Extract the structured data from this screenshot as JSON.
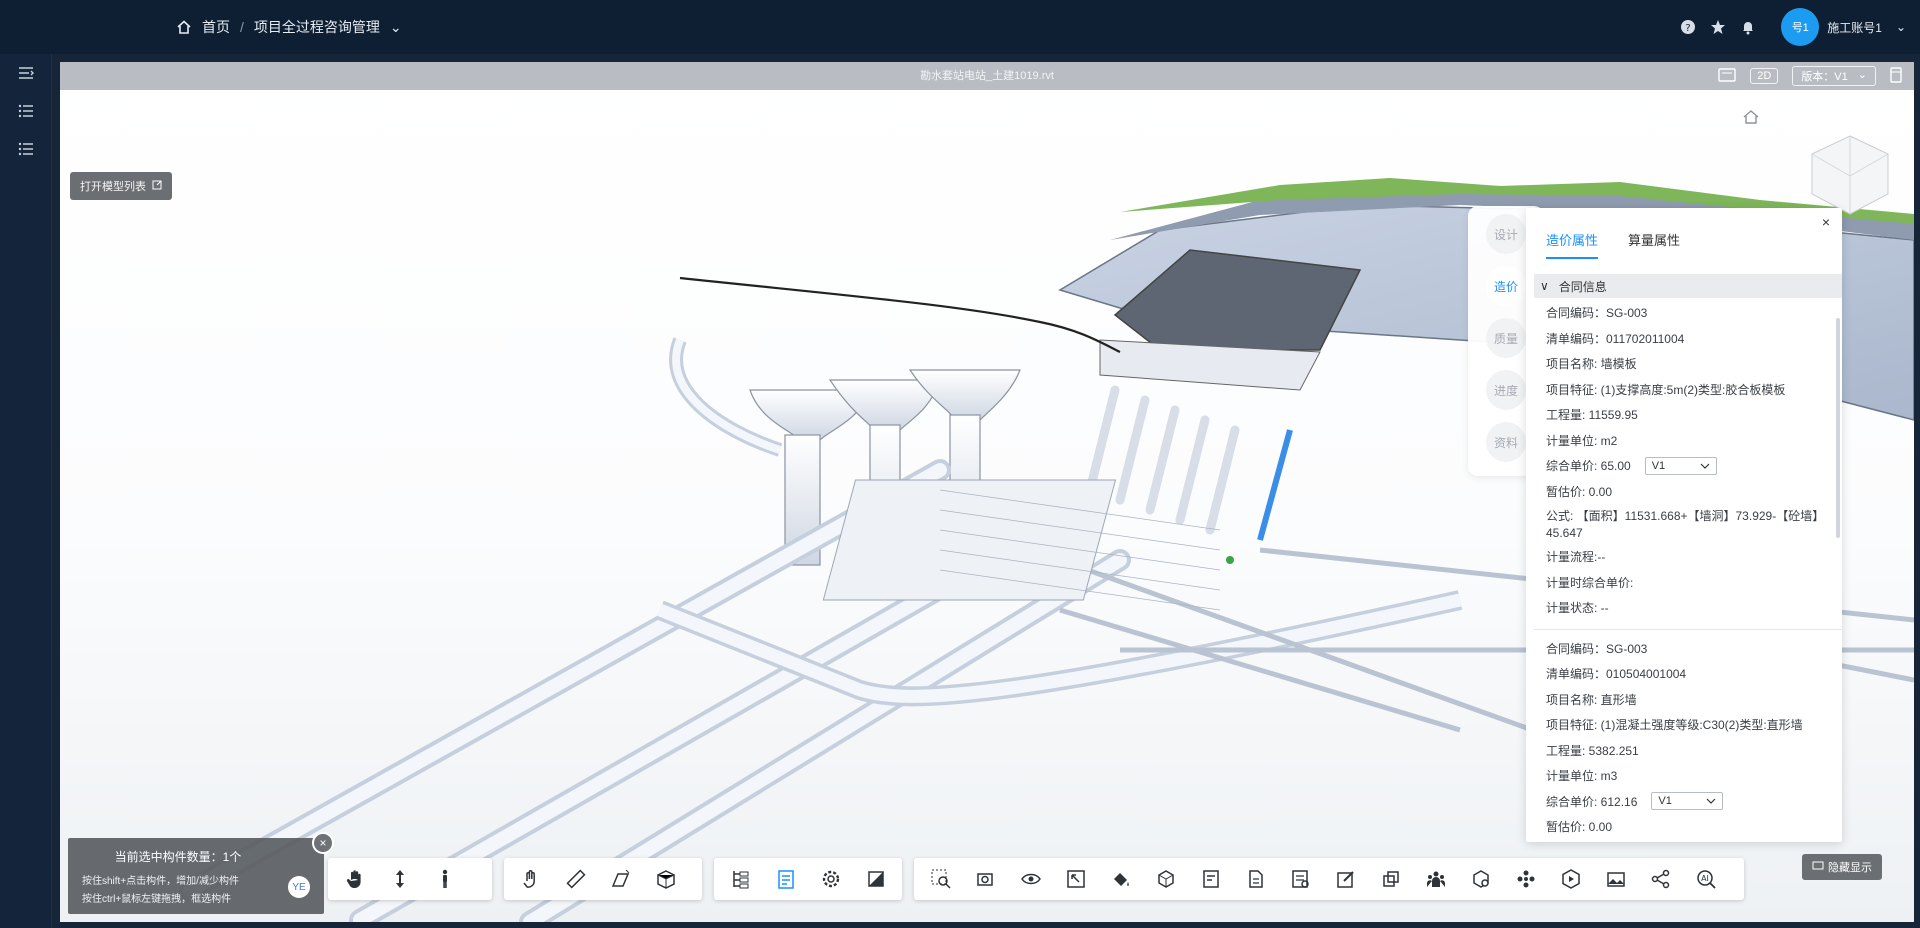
{
  "breadcrumb": {
    "home": "首页",
    "separator": "/",
    "current": "项目全过程咨询管理",
    "caret": "⌄"
  },
  "header_icons": [
    "help-icon",
    "star-icon",
    "bell-icon"
  ],
  "user": {
    "avatar_text": "号1",
    "name": "施工账号1",
    "caret": "⌄"
  },
  "sidebar": {
    "items": [
      "menu-toggle-icon",
      "list-icon",
      "list-icon"
    ]
  },
  "viewer": {
    "file_title": "勘水套站电站_土建1019.rvt",
    "view_mode": "2D",
    "version_label": "版本：V1",
    "version_caret": "⌄",
    "open_model_list": "打开模型列表",
    "hide_ui": "隐藏显示"
  },
  "side_tabs": [
    {
      "label": "设计",
      "active": false
    },
    {
      "label": "造价",
      "active": true
    },
    {
      "label": "质量",
      "active": false
    },
    {
      "label": "进度",
      "active": false
    },
    {
      "label": "资料",
      "active": false
    }
  ],
  "panel": {
    "close": "×",
    "tabs": [
      {
        "label": "造价属性",
        "active": true
      },
      {
        "label": "算量属性",
        "active": false
      }
    ],
    "section": {
      "chevron": "∨",
      "title": "合同信息"
    },
    "groups": [
      {
        "rows": [
          "合同编码：SG-003",
          "清单编码：011702011004",
          "项目名称: 墙模板",
          "项目特征: (1)支撑高度:5m(2)类型:胶合板模板",
          "工程量: 11559.95",
          "计量单位: m2"
        ],
        "price_label": "综合单价: 65.00",
        "price_version": "V1",
        "rows_after": [
          "暂估价: 0.00",
          "公式: 【面积】11531.668+【墙洞】73.929-【砼墙】45.647",
          "计量流程:--",
          "计量时综合单价:",
          "计量状态: --"
        ]
      },
      {
        "rows": [
          "合同编码：SG-003",
          "清单编码：010504001004",
          "项目名称: 直形墙",
          "项目特征: (1)混凝土强度等级:C30(2)类型:直形墙",
          "工程量: 5382.251",
          "计量单位: m3"
        ],
        "price_label": "综合单价: 612.16",
        "price_version": "V1",
        "rows_after": [
          "暂估价: 0.00"
        ]
      }
    ]
  },
  "selection": {
    "count_text": "当前选中构件数量：1个",
    "tip1": "按住shift+点击构件，增加/减少构件",
    "tip2": "按住ctrl+鼠标左键拖拽，框选构件",
    "close": "×",
    "filter": "YE"
  },
  "toolbar": {
    "groups": [
      [
        "hand-pan-icon",
        "vertical-move-icon",
        "person-walk-icon"
      ],
      [
        "gesture-icon",
        "measure-ruler-icon",
        "section-plane-icon",
        "section-box-icon"
      ],
      [
        "model-tree-icon",
        "properties-icon",
        "settings-icon",
        "material-icon"
      ],
      [
        "zoom-box-icon",
        "camera-view-icon",
        "visibility-icon",
        "fit-window-icon",
        "paint-icon",
        "component-icon",
        "annotation-icon",
        "document-icon",
        "report-icon",
        "edit-note-icon",
        "copy-icon",
        "people-icon",
        "cube-sync-icon",
        "explode-icon",
        "progress-icon",
        "scene-icon",
        "share-icon",
        "ai-search-icon"
      ]
    ],
    "active": "properties-icon"
  },
  "colors": {
    "accent": "#1890ff",
    "topbar": "#0f1f33",
    "grass": "#7fb65a"
  }
}
